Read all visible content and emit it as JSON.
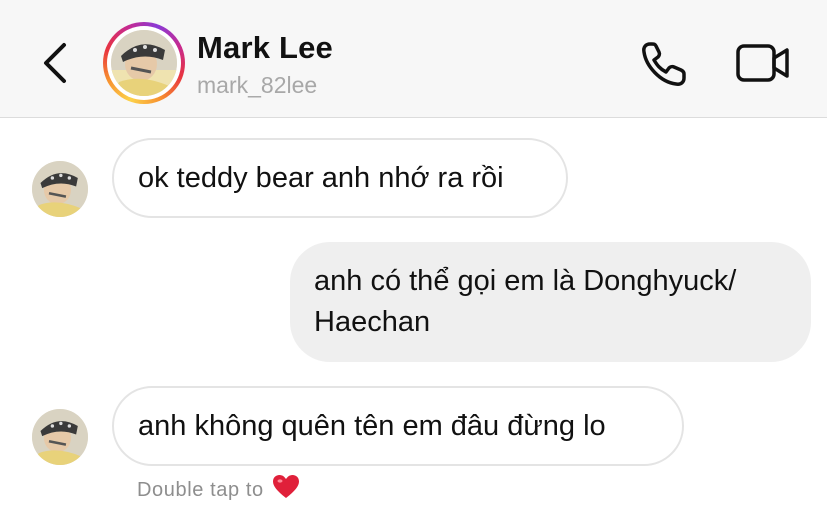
{
  "header": {
    "name": "Mark Lee",
    "username": "mark_82lee"
  },
  "messages": [
    {
      "direction": "incoming",
      "text": "ok teddy bear anh nhớ ra rồi"
    },
    {
      "direction": "outgoing",
      "text_line1": "anh có thể gọi em là Donghyuck/",
      "text_line2": "Haechan"
    },
    {
      "direction": "incoming",
      "text": "anh không quên tên em đâu đừng lo"
    }
  ],
  "reaction_hint": {
    "label": "Double tap to",
    "emoji": "❤️"
  },
  "icons": {
    "back": "chevron-left-icon",
    "call": "phone-icon",
    "video": "video-camera-icon"
  },
  "colors": {
    "story_ring": [
      "#fcd24a",
      "#e8343f",
      "#8a3ad6"
    ],
    "outgoing_bubble": "#efefef",
    "incoming_border": "#e4e4e4"
  }
}
